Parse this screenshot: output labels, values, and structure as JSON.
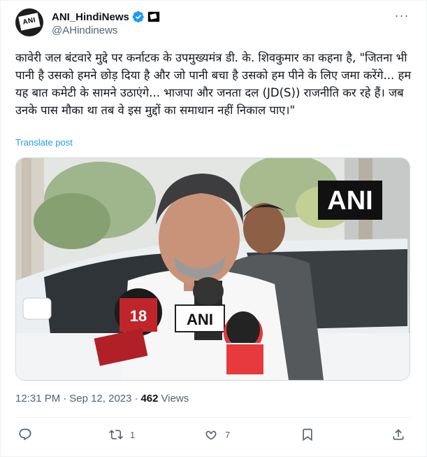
{
  "account": {
    "display_name": "ANI_HindiNews",
    "handle": "@AHindinews",
    "avatar_text": "ANI"
  },
  "tweet": {
    "text": "कावेरी जल बंटवारे मुद्दे पर कर्नाटक के उपमुख्यमंत्र डी. के. शिवकुमार का कहना है, \"जितना भी पानी है उसको हमने छोड़ दिया है और जो पानी बचा है उसको हम पीने के लिए जमा करेंगे... हम यह बात कमेटी के सामने उठाएंगे... भाजपा और जनता दल (JD(S)) राजनीति कर रहे हैं। जब उनके पास मौका था तब वे इस मुद्दों का समाधान नहीं निकाल पाए।\"",
    "translate_label": "Translate post"
  },
  "media": {
    "watermark": "ANI",
    "mic_labels": [
      "18",
      "ANI"
    ],
    "colors": {
      "sky": "#eef1ee",
      "car": "#e9ecee",
      "shirt": "#ffffff",
      "ani_bg": "#111111"
    }
  },
  "meta": {
    "time": "12:31 PM",
    "separator": "·",
    "date": "Sep 12, 2023",
    "views_count": "462",
    "views_label": "Views"
  },
  "actions": {
    "reply_count": "",
    "repost_count": "1",
    "like_count": "7"
  },
  "colors": {
    "accent": "#1d9bf0",
    "text": "#0f1419",
    "muted": "#536471"
  }
}
